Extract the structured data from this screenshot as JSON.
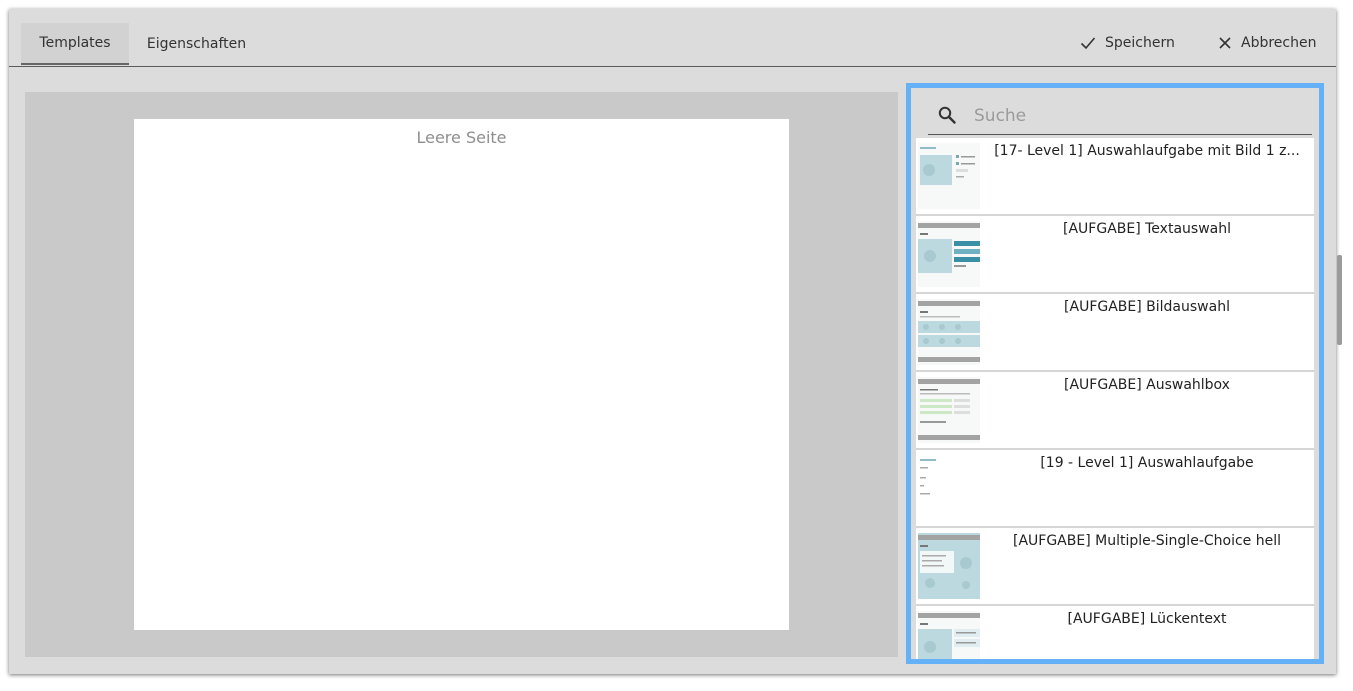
{
  "tabs": {
    "templates": "Templates",
    "properties": "Eigenschaften"
  },
  "actions": {
    "save": "Speichern",
    "cancel": "Abbrechen"
  },
  "preview": {
    "page_label": "Leere Seite"
  },
  "search": {
    "placeholder": "Suche",
    "value": ""
  },
  "templates": [
    {
      "label": "[17- Level 1] Auswahlaufgabe mit Bild 1 z..."
    },
    {
      "label": "[AUFGABE] Textauswahl"
    },
    {
      "label": "[AUFGABE] Bildauswahl"
    },
    {
      "label": "[AUFGABE] Auswahlbox"
    },
    {
      "label": "[19 - Level 1] Auswahlaufgabe"
    },
    {
      "label": "[AUFGABE] Multiple-Single-Choice hell"
    },
    {
      "label": "[AUFGABE] Lückentext"
    }
  ],
  "colors": {
    "dialog_background": "#dcdcdc",
    "preview_background": "#c9c9c9",
    "panel_highlight_border": "#64b1f7",
    "thumbnail_accent": "#bcd9df"
  }
}
